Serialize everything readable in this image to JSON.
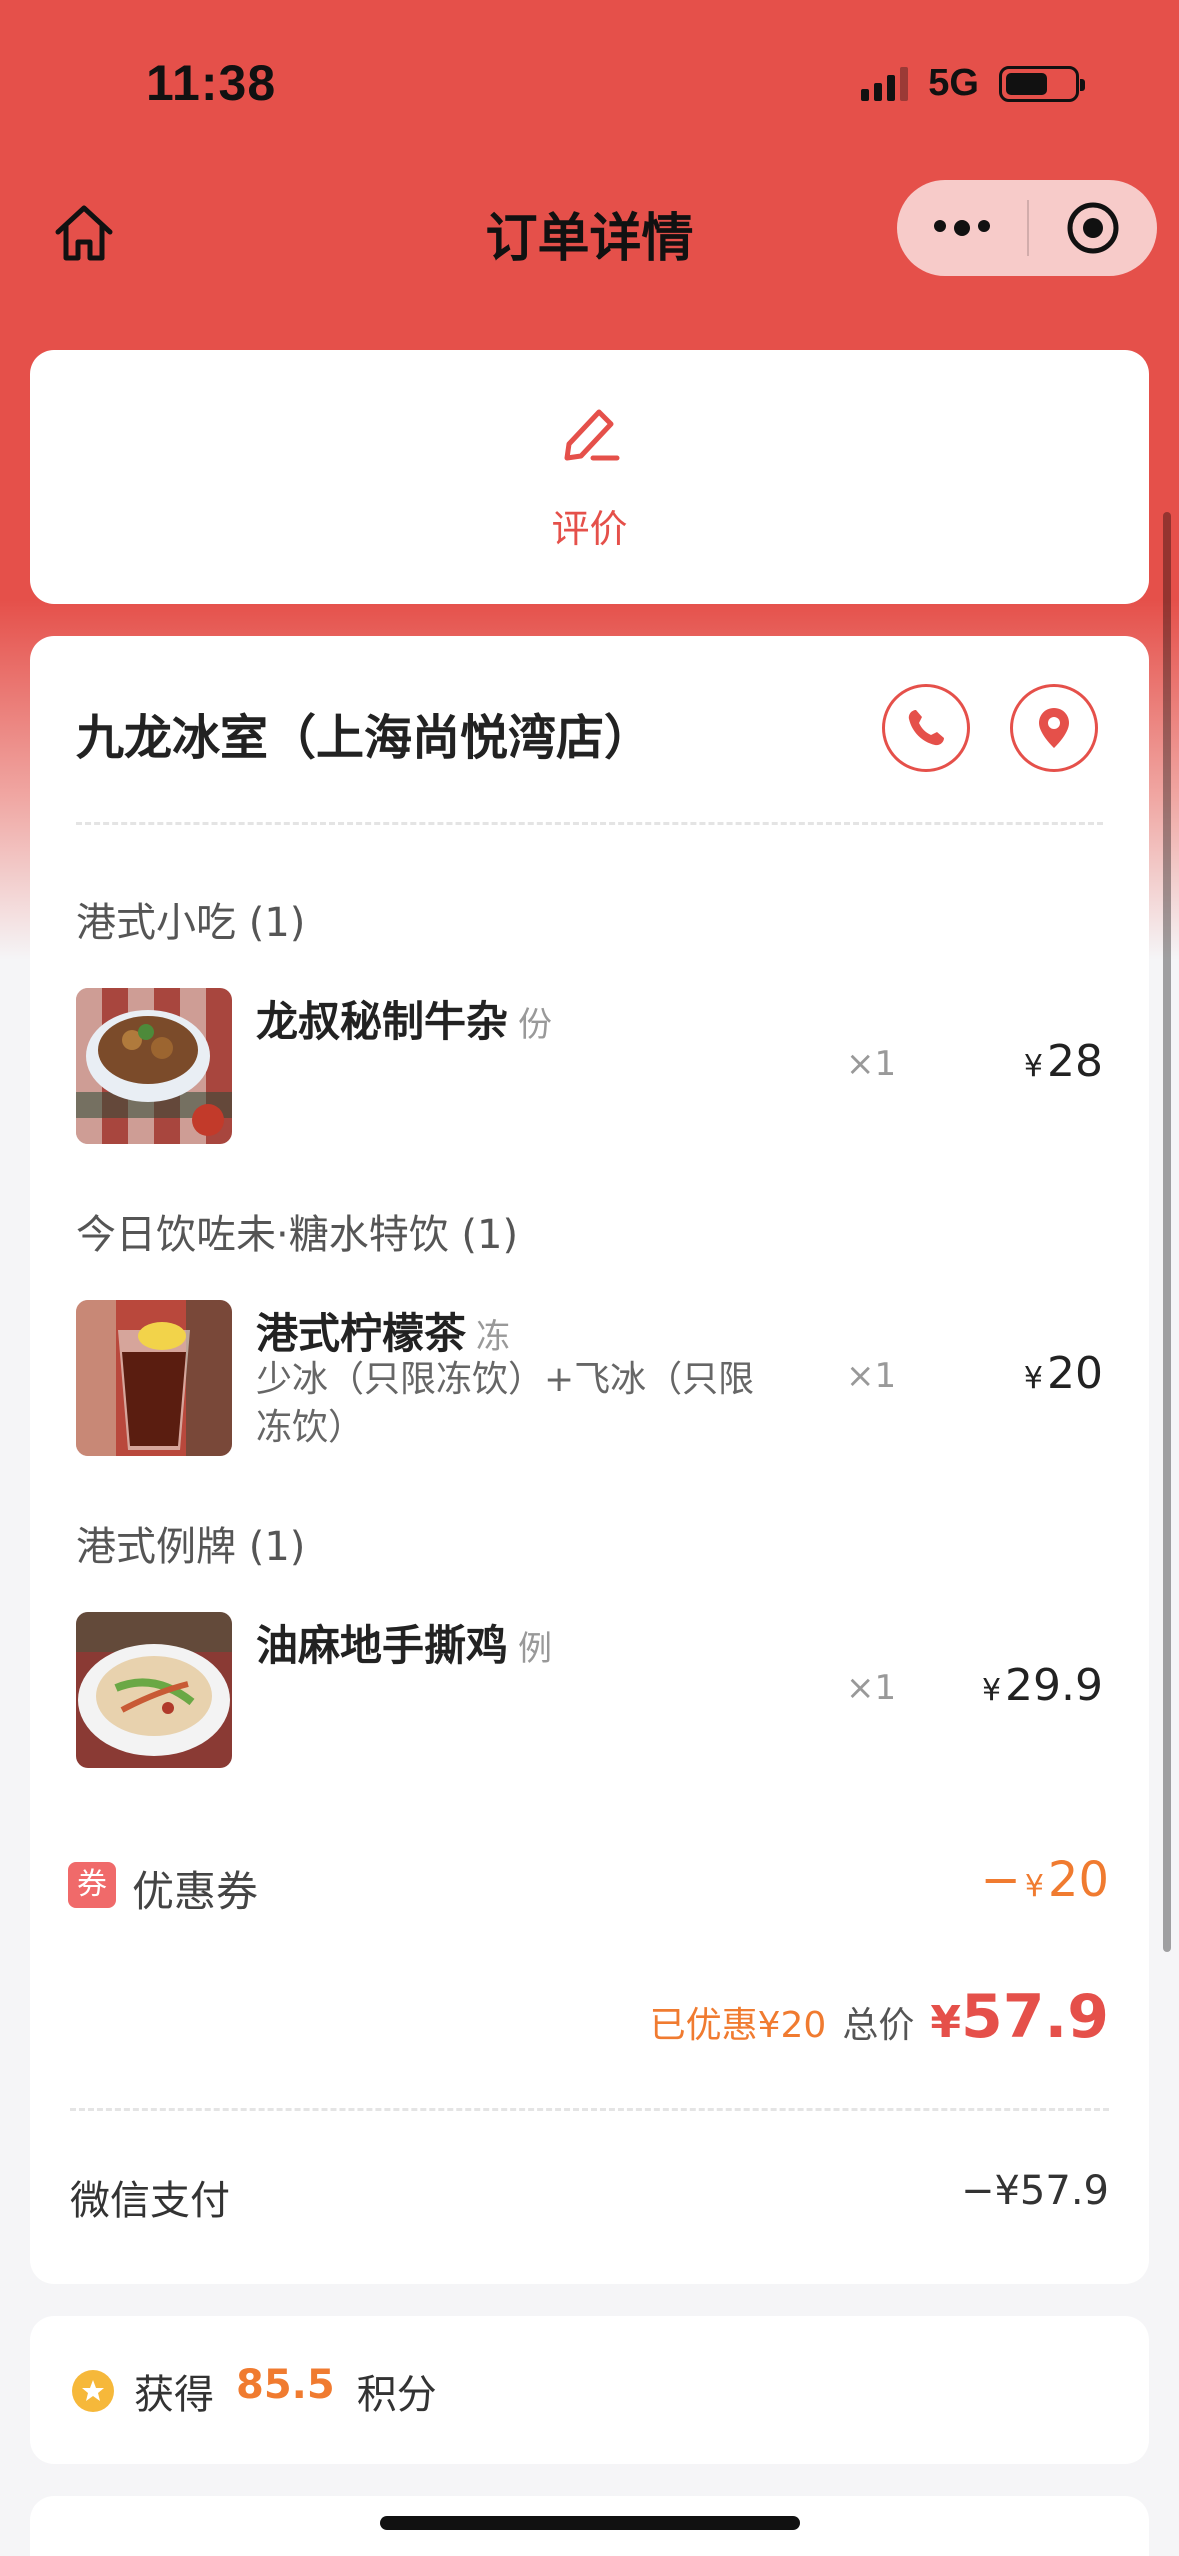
{
  "status_bar": {
    "time": "11:38",
    "network": "5G"
  },
  "nav": {
    "title": "订单详情"
  },
  "review": {
    "label": "评价"
  },
  "store": {
    "name": "九龙冰室（上海尚悦湾店）"
  },
  "sections": [
    {
      "title": "港式小吃 (1)",
      "item": {
        "name": "龙叔秘制牛杂",
        "unit": "份",
        "spec": "",
        "qty": "×1",
        "price": "28"
      }
    },
    {
      "title": "今日饮咗未·糖水特饮 (1)",
      "item": {
        "name": "港式柠檬茶",
        "unit": "冻",
        "spec": "少冰（只限冻饮）+飞冰（只限冻饮）",
        "qty": "×1",
        "price": "20"
      }
    },
    {
      "title": "港式例牌 (1)",
      "item": {
        "name": "油麻地手撕鸡",
        "unit": "例",
        "spec": "",
        "qty": "×1",
        "price": "29.9"
      }
    }
  ],
  "currency": "¥",
  "coupon": {
    "badge": "券",
    "label": "优惠券",
    "sign": "−",
    "amount": "20"
  },
  "summary": {
    "saved": "已优惠¥20",
    "total_label": "总价",
    "total": "57.9"
  },
  "payment": {
    "label": "微信支付",
    "amount": "−¥57.9"
  },
  "points": {
    "prefix": "获得",
    "value": "85.5",
    "suffix": "积分"
  },
  "colors": {
    "brand_red": "#e5504a",
    "accent_orange": "#f07b30"
  }
}
